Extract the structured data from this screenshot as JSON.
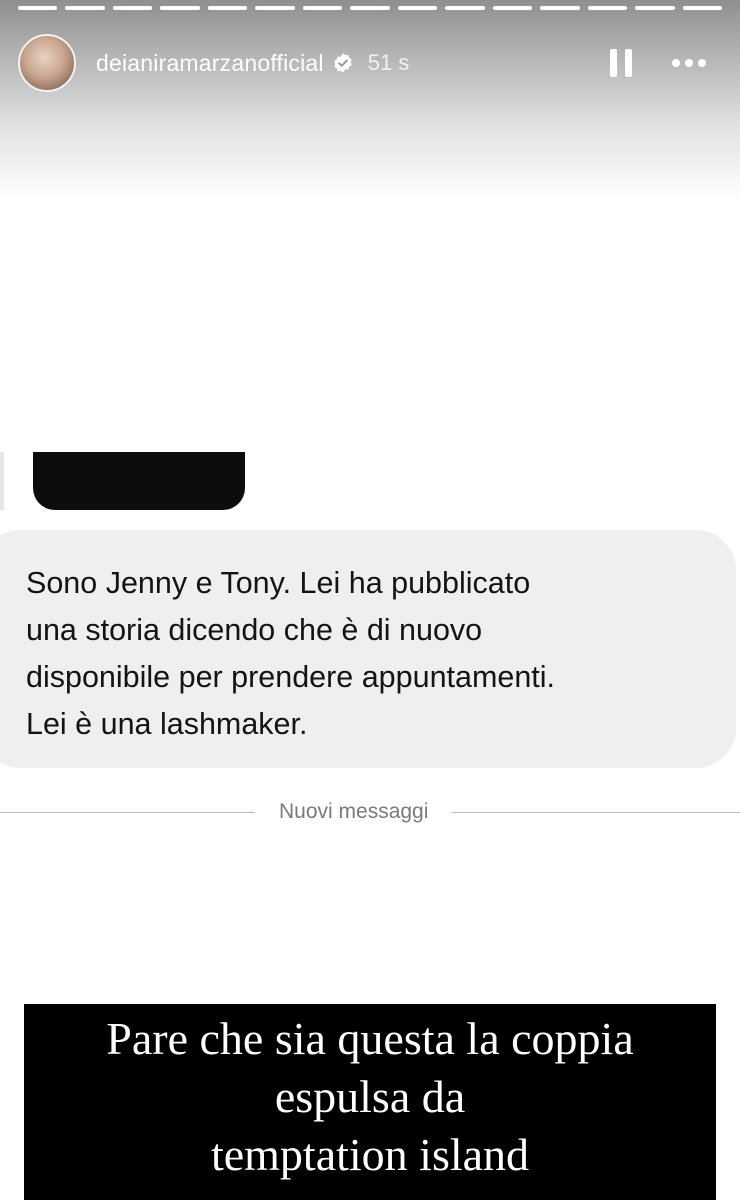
{
  "story": {
    "progress_segments": 15,
    "username": "deianiramarzanofficial",
    "verified_icon": "verified-badge-icon",
    "time_ago": "51 s",
    "pause_icon": "pause-icon",
    "more_icon": "more-options-icon"
  },
  "screenshot": {
    "message_text": "Sono Jenny e Tony. Lei ha pubblicato\nuna storia dicendo che è di nuovo\ndisponibile per prendere appuntamenti.\nLei è una lashmaker.",
    "divider_label": "Nuovi messaggi"
  },
  "caption": {
    "lines": [
      "Pare che sia questa la coppia",
      "espulsa da",
      "temptation island"
    ]
  },
  "colors": {
    "bubble": "#efefef",
    "caption_bg": "#000000",
    "caption_text": "#ffffff"
  }
}
